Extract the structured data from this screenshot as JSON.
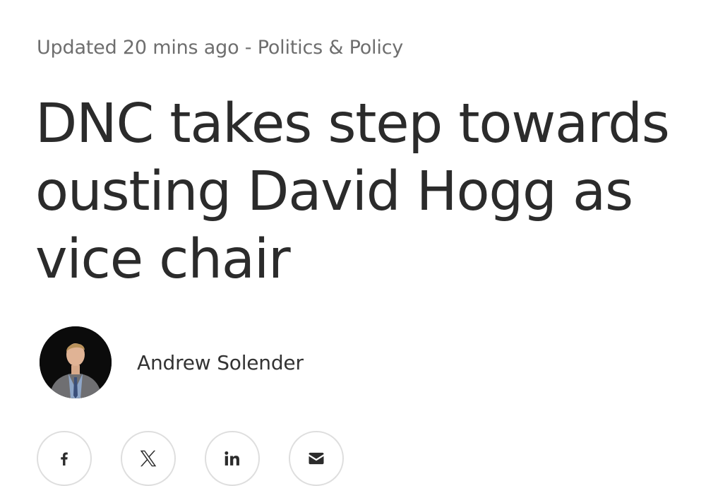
{
  "meta": {
    "updated": "Updated 20 mins ago",
    "separator": " - ",
    "section": "Politics & Policy"
  },
  "headline": "DNC takes step towards ousting David Hogg as vice chair",
  "byline": {
    "author": "Andrew Solender"
  },
  "share": {
    "buttons": [
      "facebook-icon",
      "x-icon",
      "linkedin-icon",
      "email-icon"
    ]
  },
  "colors": {
    "text": "#2b2b2b",
    "meta": "#6e6e6e",
    "border": "#dedede"
  }
}
